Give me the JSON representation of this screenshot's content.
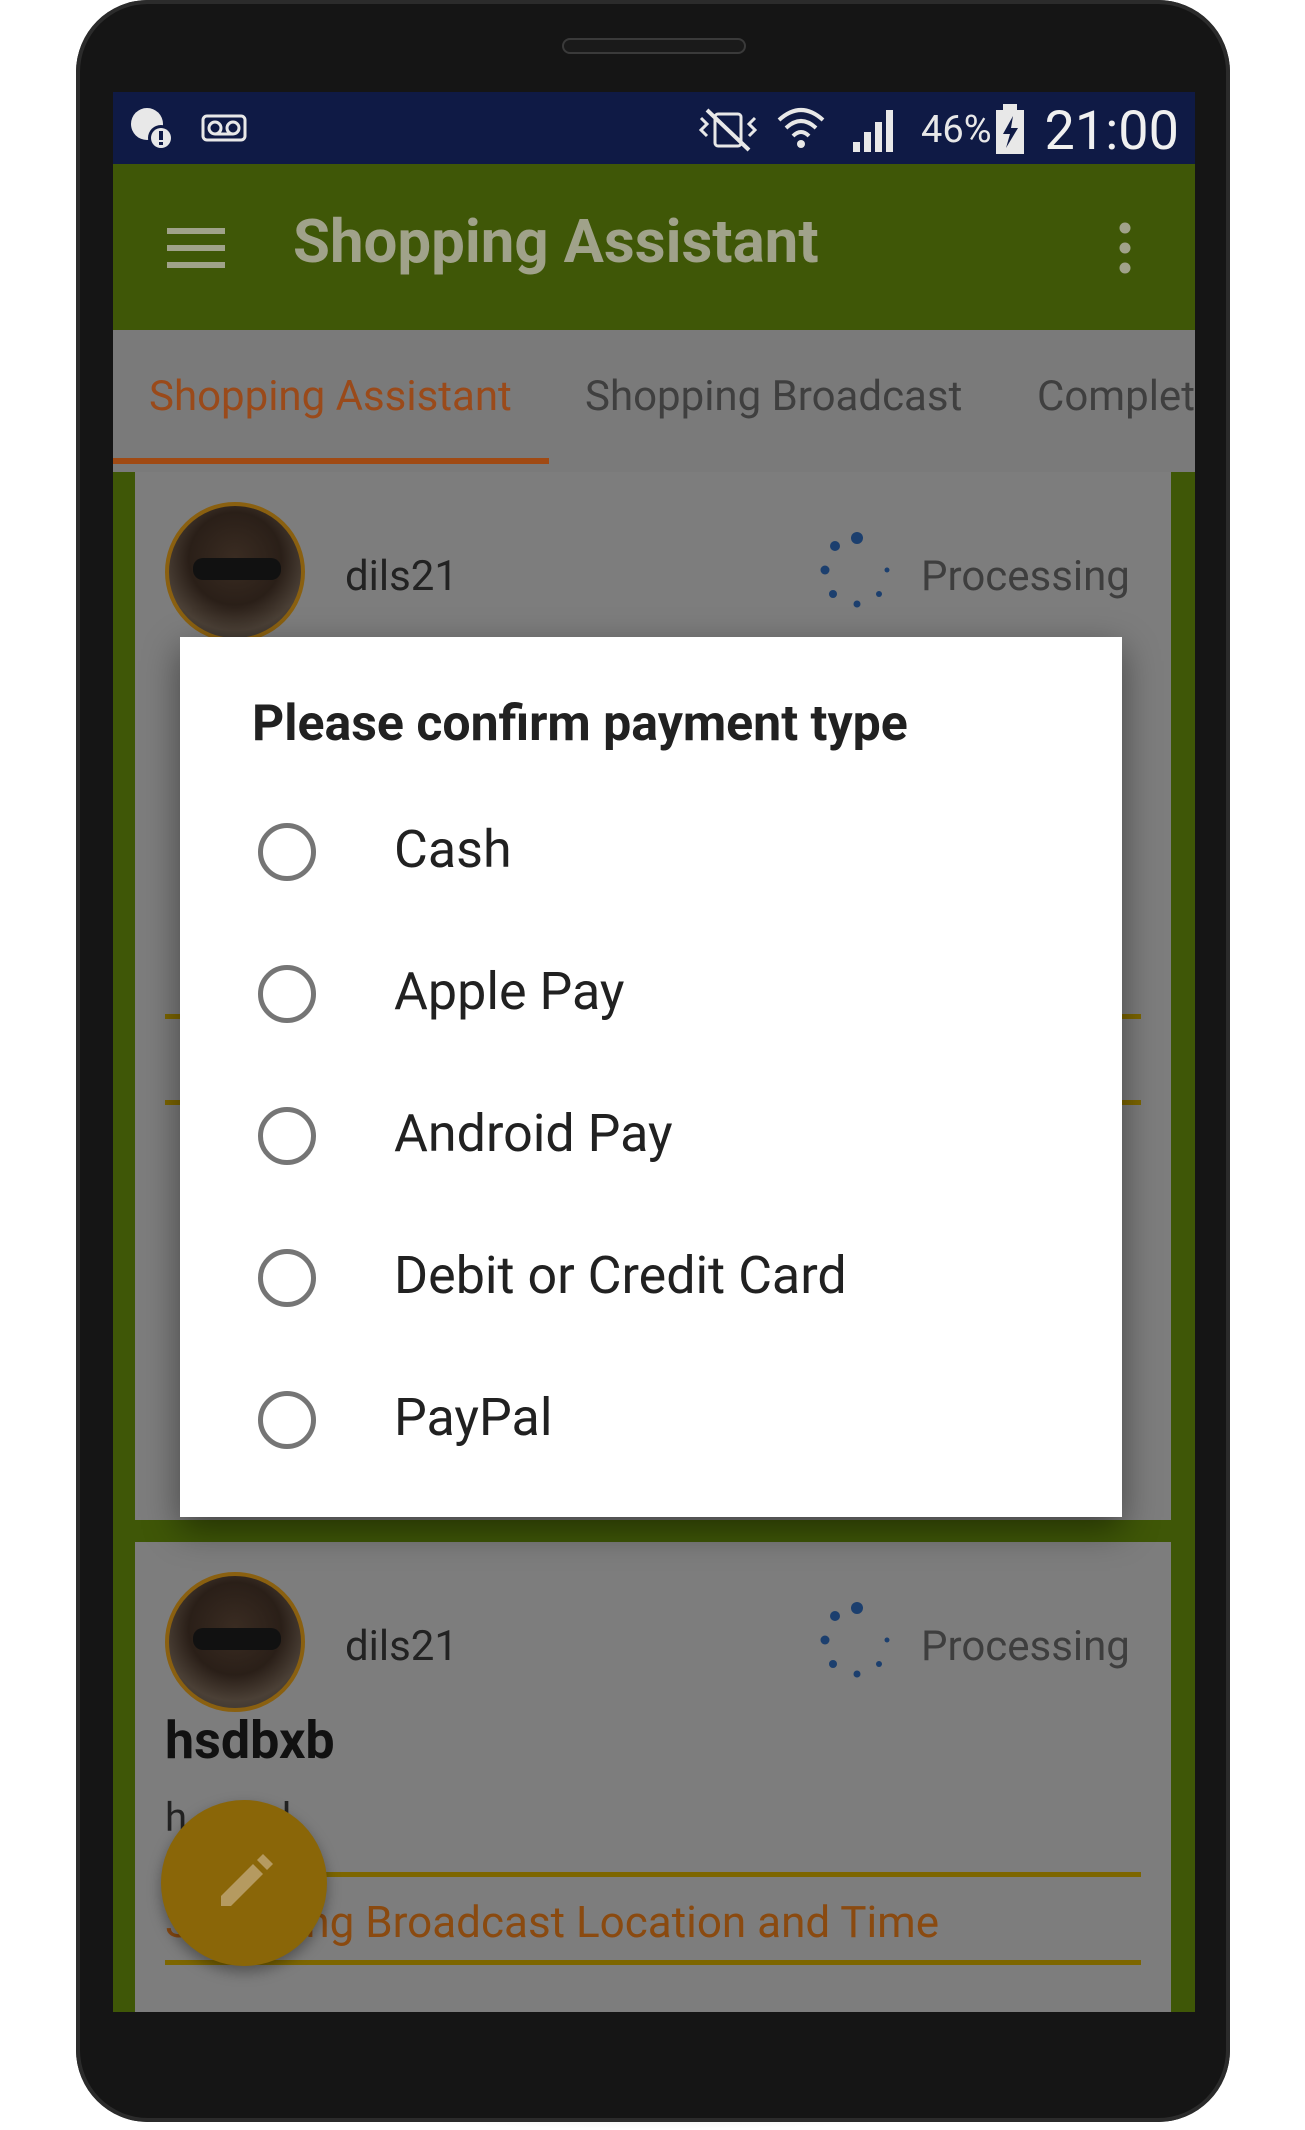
{
  "status_bar": {
    "battery": "46%",
    "time": "21:00"
  },
  "app_bar": {
    "title": "Shopping Assistant"
  },
  "tabs": [
    {
      "label": "Shopping Assistant"
    },
    {
      "label": "Shopping Broadcast"
    },
    {
      "label": "Complet"
    }
  ],
  "cards": [
    {
      "user": "dils21",
      "status": "Processing"
    },
    {
      "user": "dils21",
      "status": "Processing",
      "title": "hsdbxb",
      "body": "h      nd",
      "section_title": "Sh     ping Broadcast Location and Time"
    }
  ],
  "dialog": {
    "title": "Please confirm payment type",
    "options": [
      {
        "label": "Cash"
      },
      {
        "label": "Apple Pay"
      },
      {
        "label": "Android Pay"
      },
      {
        "label": "Debit or Credit Card"
      },
      {
        "label": "PayPal"
      }
    ]
  },
  "colors": {
    "app_bar": "#7cb518",
    "accent": "#e07b2a",
    "status_bar": "#1a2a78",
    "fab": "#f0b323"
  }
}
